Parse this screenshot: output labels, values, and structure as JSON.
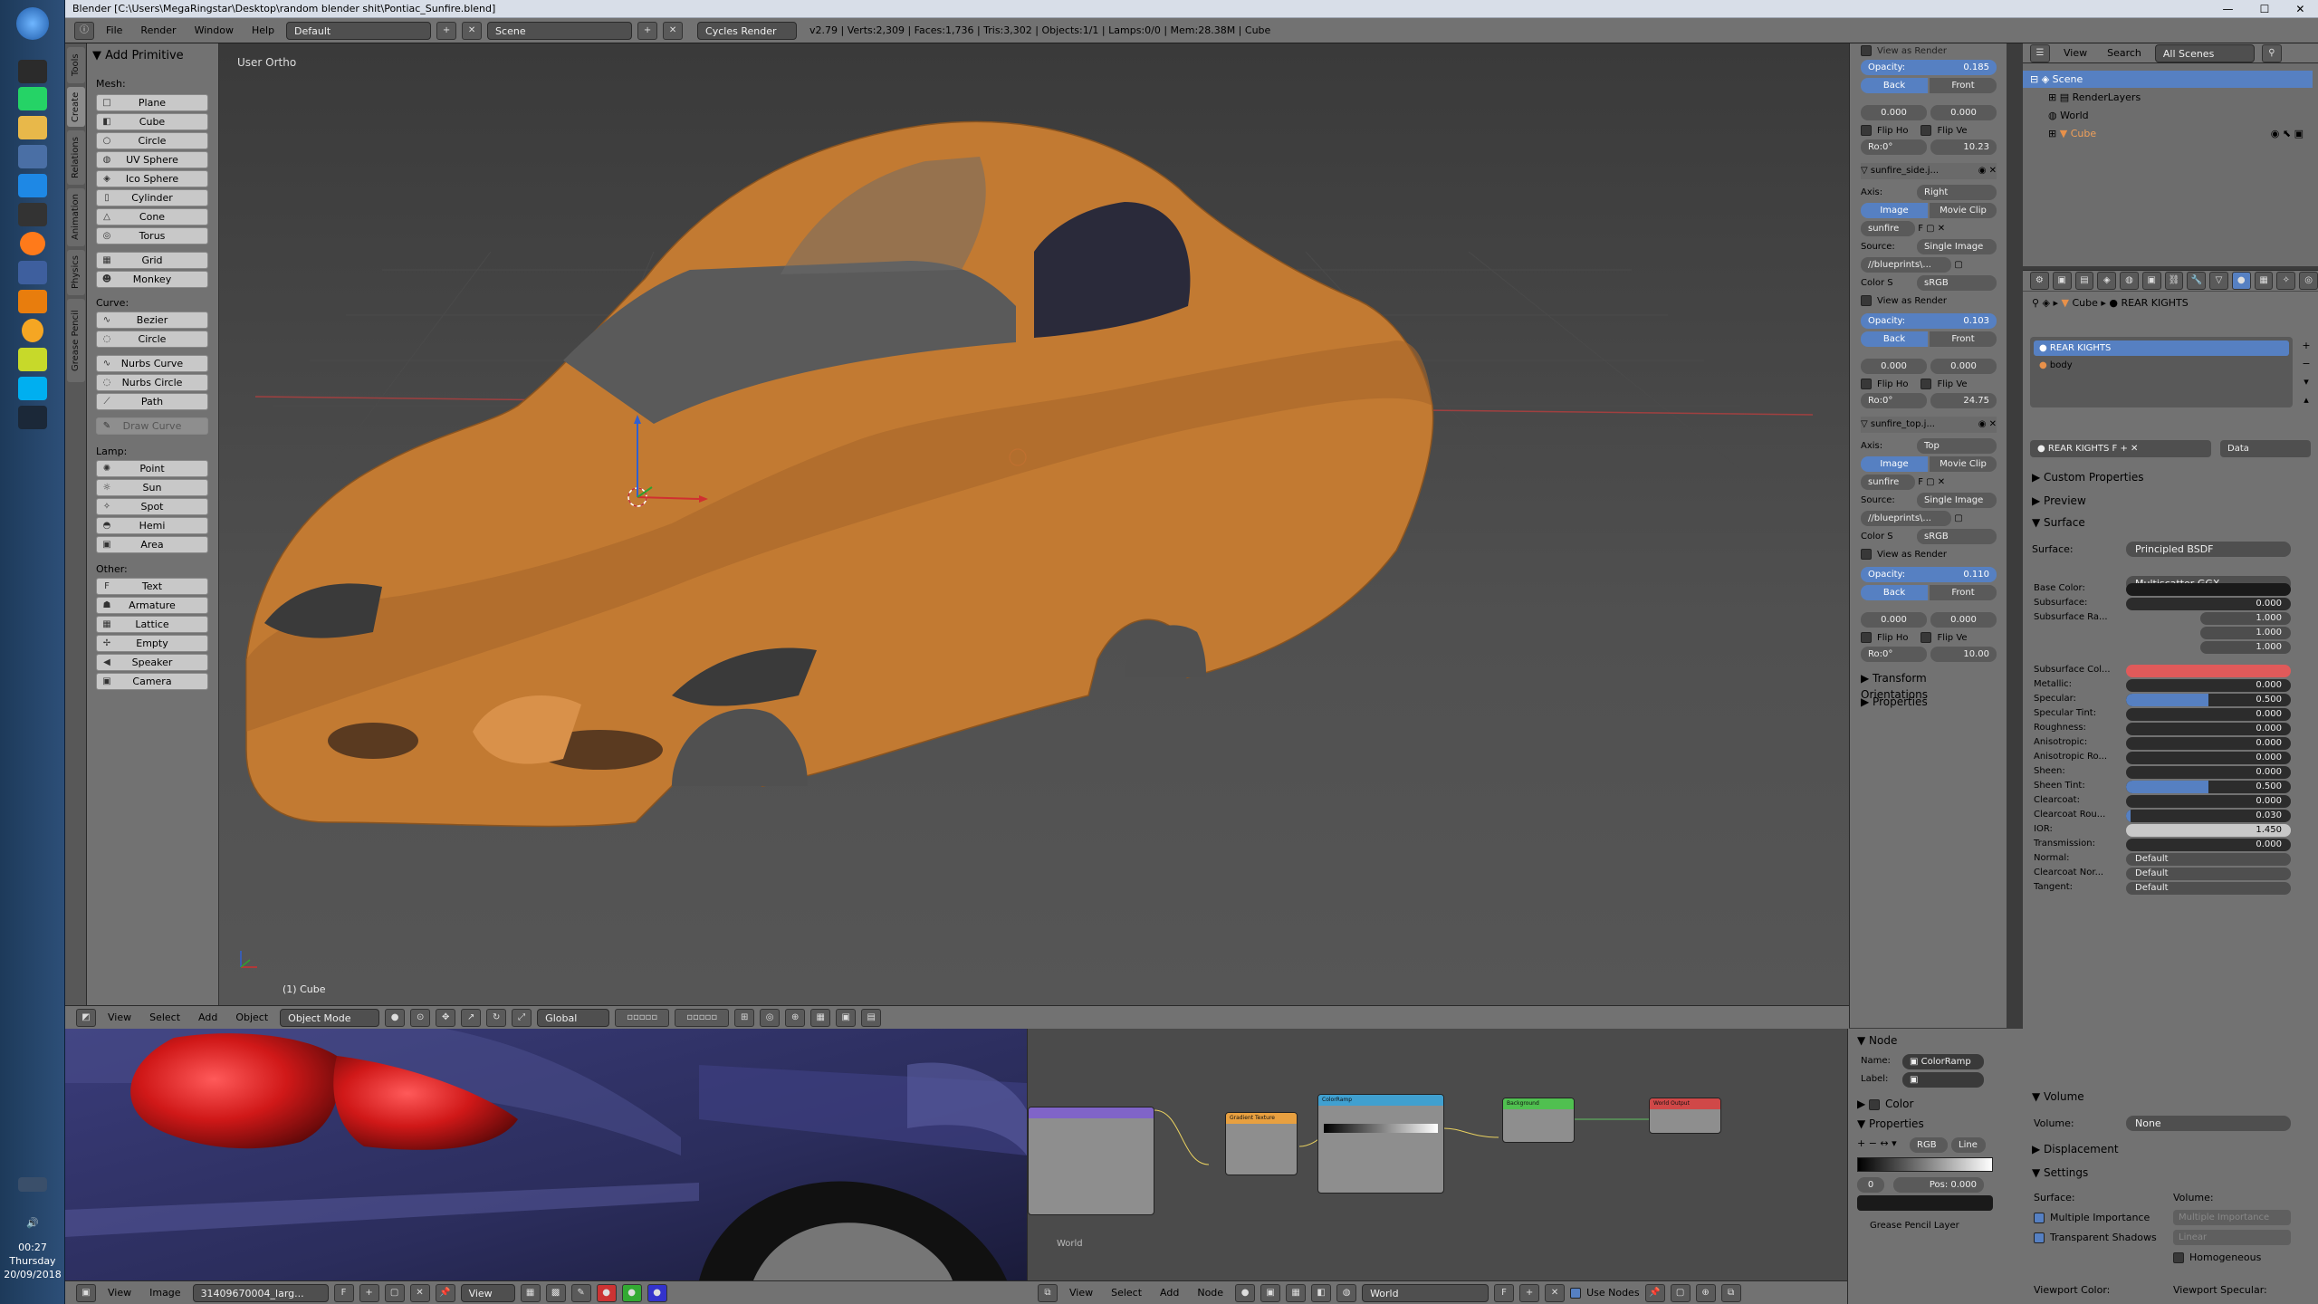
{
  "window": {
    "title": "Blender [C:\\Users\\MegaRingstar\\Desktop\\random blender shit\\Pontiac_Sunfire.blend]",
    "controls": [
      "—",
      "☐",
      "✕"
    ]
  },
  "infobar": {
    "menus": [
      "File",
      "Render",
      "Window",
      "Help"
    ],
    "layout": "Default",
    "scene": "Scene",
    "engine": "Cycles Render",
    "stats": "v2.79 | Verts:2,309 | Faces:1,736 | Tris:3,302 | Objects:1/1 | Lamps:0/0 | Mem:28.38M | Cube"
  },
  "vtabs": [
    "Tools",
    "Create",
    "Relations",
    "Animation",
    "Physics",
    "Grease Pencil"
  ],
  "toolshelf": {
    "header": "Add Primitive",
    "mesh_label": "Mesh:",
    "mesh": [
      "Plane",
      "Cube",
      "Circle",
      "UV Sphere",
      "Ico Sphere",
      "Cylinder",
      "Cone",
      "Torus",
      "Grid",
      "Monkey"
    ],
    "curve_label": "Curve:",
    "curve": [
      "Bezier",
      "Circle",
      "Nurbs Curve",
      "Nurbs Circle",
      "Path"
    ],
    "draw_curve": "Draw Curve",
    "lamp_label": "Lamp:",
    "lamp": [
      "Point",
      "Sun",
      "Spot",
      "Hemi",
      "Area"
    ],
    "other_label": "Other:",
    "other": [
      "Text",
      "Armature",
      "Lattice",
      "Empty",
      "Speaker",
      "Camera"
    ]
  },
  "viewport": {
    "view_name": "User Ortho",
    "active_object": "(1) Cube",
    "header_menus": [
      "View",
      "Select",
      "Add",
      "Object"
    ],
    "mode": "Object Mode",
    "orientation": "Global"
  },
  "background_images": {
    "top_partial": "View as Render",
    "bg1": {
      "opacity_label": "Opacity:",
      "opacity": "0.185",
      "back": "Back",
      "front": "Front",
      "x": "0.000",
      "y": "0.000",
      "flip_h": "Flip Ho",
      "flip_v": "Flip Ve",
      "rot": "Ro:0°",
      "size": "10.23"
    },
    "bg2": {
      "name": "sunfire_side.j...",
      "axis_label": "Axis:",
      "axis": "Right",
      "tab_image": "Image",
      "tab_clip": "Movie Clip",
      "file": "sunfire",
      "source_label": "Source:",
      "source": "Single Image",
      "path": "//blueprints\\...",
      "color_label": "Color S",
      "color": "sRGB",
      "view_render": "View as Render",
      "opacity_label": "Opacity:",
      "opacity": "0.103",
      "back": "Back",
      "front": "Front",
      "x": "0.000",
      "y": "0.000",
      "flip_h": "Flip Ho",
      "flip_v": "Flip Ve",
      "rot": "Ro:0°",
      "size": "24.75"
    },
    "bg3": {
      "name": "sunfire_top.j...",
      "axis_label": "Axis:",
      "axis": "Top",
      "tab_image": "Image",
      "tab_clip": "Movie Clip",
      "file": "sunfire",
      "source_label": "Source:",
      "source": "Single Image",
      "path": "//blueprints\\...",
      "color_label": "Color S",
      "color": "sRGB",
      "view_render": "View as Render",
      "opacity_label": "Opacity:",
      "opacity": "0.110",
      "back": "Back",
      "front": "Front",
      "x": "0.000",
      "y": "0.000",
      "flip_h": "Flip Ho",
      "flip_v": "Flip Ve",
      "rot": "Ro:0°",
      "size": "10.00"
    },
    "transform_orient": "Transform Orientations",
    "properties": "Properties"
  },
  "outliner": {
    "menus": [
      "View",
      "Search"
    ],
    "scenes": "All Scenes",
    "rows": [
      "Scene",
      "RenderLayers",
      "World",
      "Cube"
    ]
  },
  "properties": {
    "breadcrumb_obj": "Cube",
    "breadcrumb_mat": "REAR KIGHTS",
    "slots": [
      "REAR KIGHTS",
      "body"
    ],
    "material_name": "REAR KIGHTS",
    "data_sel": "Data",
    "sections": {
      "custom": "Custom Properties",
      "preview": "Preview",
      "surface": "Surface",
      "volume": "Volume",
      "displacement": "Displacement",
      "settings": "Settings"
    },
    "surface_label": "Surface:",
    "surface_shader": "Principled BSDF",
    "distribution": "Multiscatter GGX",
    "params": [
      {
        "label": "Base Color:",
        "value": "",
        "fill": 0
      },
      {
        "label": "Subsurface:",
        "value": "0.000",
        "fill": 0.0
      },
      {
        "label": "Subsurface Ra...",
        "value": "1.000",
        "fill": 0
      },
      {
        "label": "",
        "value": "1.000",
        "fill": 0
      },
      {
        "label": "",
        "value": "1.000",
        "fill": 0
      },
      {
        "label": "Subsurface Col...",
        "value": "",
        "fill": 0
      },
      {
        "label": "Metallic:",
        "value": "0.000",
        "fill": 0
      },
      {
        "label": "Specular:",
        "value": "0.500",
        "fill": 0.5
      },
      {
        "label": "Specular Tint:",
        "value": "0.000",
        "fill": 0
      },
      {
        "label": "Roughness:",
        "value": "0.000",
        "fill": 0
      },
      {
        "label": "Anisotropic:",
        "value": "0.000",
        "fill": 0
      },
      {
        "label": "Anisotropic Ro...",
        "value": "0.000",
        "fill": 0
      },
      {
        "label": "Sheen:",
        "value": "0.000",
        "fill": 0
      },
      {
        "label": "Sheen Tint:",
        "value": "0.500",
        "fill": 0.5
      },
      {
        "label": "Clearcoat:",
        "value": "0.000",
        "fill": 0
      },
      {
        "label": "Clearcoat Rou...",
        "value": "0.030",
        "fill": 0.03
      },
      {
        "label": "IOR:",
        "value": "1.450",
        "fill": 0
      },
      {
        "label": "Transmission:",
        "value": "0.000",
        "fill": 0
      },
      {
        "label": "Normal:",
        "value": "Default",
        "fill": 0
      },
      {
        "label": "Clearcoat Nor...",
        "value": "Default",
        "fill": 0
      },
      {
        "label": "Tangent:",
        "value": "Default",
        "fill": 0
      }
    ],
    "volume_label": "Volume:",
    "volume_val": "None",
    "settings_surface": "Surface:",
    "settings_volume": "Volume:",
    "multiple_importance": "Multiple Importance",
    "transparent_shadows": "Transparent Shadows",
    "mi_dim": "Multiple Importance",
    "linear": "Linear",
    "homogeneous": "Homogeneous",
    "viewport_color": "Viewport Color:",
    "viewport_specular": "Viewport Specular:"
  },
  "colors": {
    "base_color": "#1a1a1a",
    "subsurface_color": "#e05a5a",
    "accent": "#5680c2",
    "car": "#c77a2e"
  },
  "image_editor": {
    "menus": [
      "View",
      "Image"
    ],
    "image_name": "31409670004_larg...",
    "view": "View"
  },
  "node_editor": {
    "menus": [
      "View",
      "Select",
      "Add",
      "Node"
    ],
    "world": "World",
    "use_nodes": "Use Nodes",
    "nodes": [
      "Gradient Texture",
      "ColorRamp",
      "Background",
      "World Output"
    ],
    "world_label": "World"
  },
  "node_side": {
    "node_section": "Node",
    "name_label": "Name:",
    "name": "ColorRamp",
    "label_label": "Label:",
    "color_section": "Color",
    "props_section": "Properties",
    "mode": "RGB",
    "interp": "Line",
    "index": "0",
    "pos": "Pos:  0.000",
    "grease": "Grease Pencil Layer"
  },
  "clock": {
    "time": "00:27",
    "day": "Thursday",
    "date": "20/09/2018"
  }
}
